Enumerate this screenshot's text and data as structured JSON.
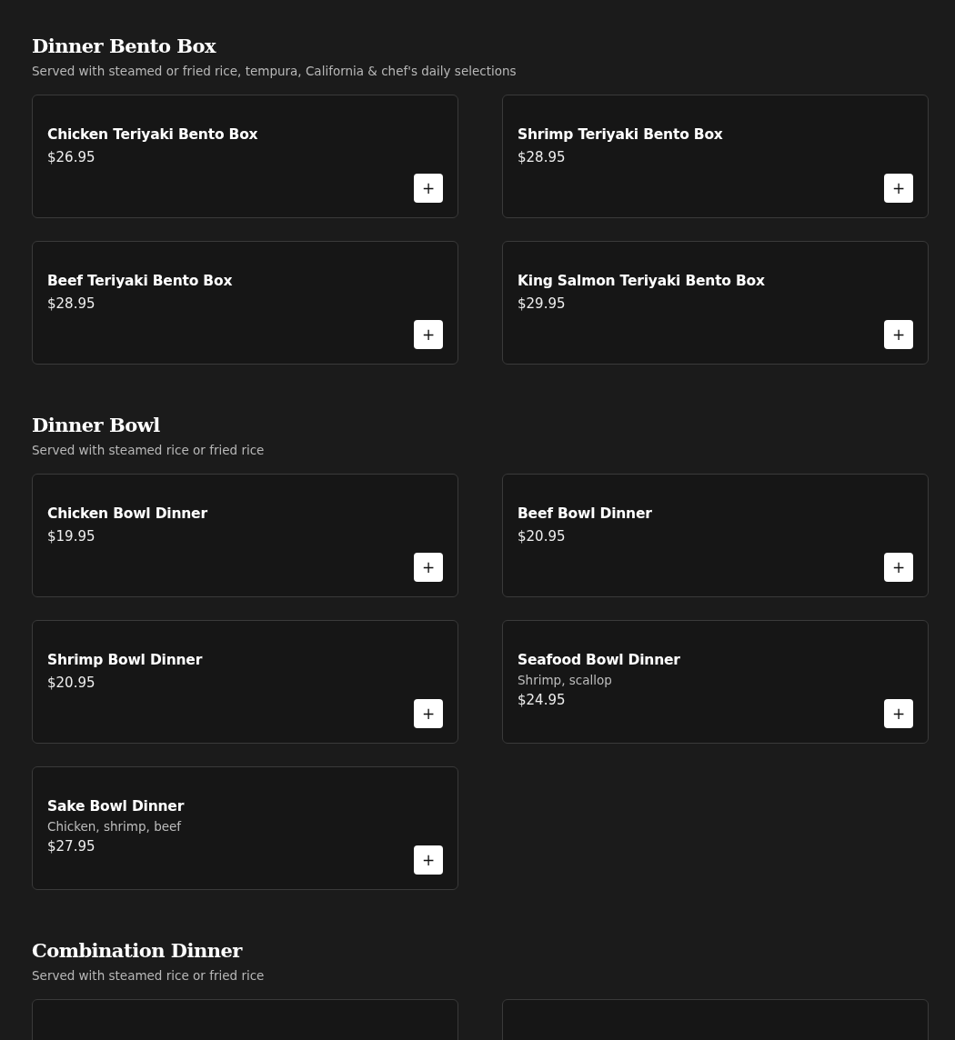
{
  "sections": [
    {
      "title": "Dinner Bento Box",
      "description": "Served with steamed or fried rice, tempura, California & chef's daily selections",
      "items": [
        {
          "kind": "dish",
          "name": "Chicken Teriyaki Bento Box",
          "price": "$26.95",
          "add_label": "+"
        },
        {
          "kind": "dish",
          "name": "Shrimp Teriyaki Bento Box",
          "price": "$28.95",
          "add_label": "+"
        },
        {
          "kind": "dish",
          "name": "Beef Teriyaki Bento Box",
          "price": "$28.95",
          "add_label": "+"
        },
        {
          "kind": "dish",
          "name": "King Salmon Teriyaki Bento Box",
          "price": "$29.95",
          "add_label": "+"
        }
      ]
    },
    {
      "title": "Dinner Bowl",
      "description": "Served with steamed rice or fried rice",
      "items": [
        {
          "kind": "dish",
          "name": "Chicken Bowl Dinner",
          "price": "$19.95",
          "add_label": "+"
        },
        {
          "kind": "dish",
          "name": "Beef Bowl Dinner",
          "price": "$20.95",
          "add_label": "+"
        },
        {
          "kind": "dish",
          "name": "Shrimp Bowl Dinner",
          "price": "$20.95",
          "add_label": "+"
        },
        {
          "kind": "dish",
          "name": "Seafood Bowl Dinner",
          "details": "Shrimp, scallop",
          "price": "$24.95",
          "add_label": "+"
        },
        {
          "kind": "dish",
          "name": "Sake Bowl Dinner",
          "details": "Chicken, shrimp, beef",
          "price": "$27.95",
          "add_label": "+"
        }
      ]
    },
    {
      "title": "Combination Dinner",
      "description": "Served with steamed rice or fried rice",
      "items": [
        {
          "kind": "cut"
        },
        {
          "kind": "cut"
        }
      ]
    }
  ]
}
